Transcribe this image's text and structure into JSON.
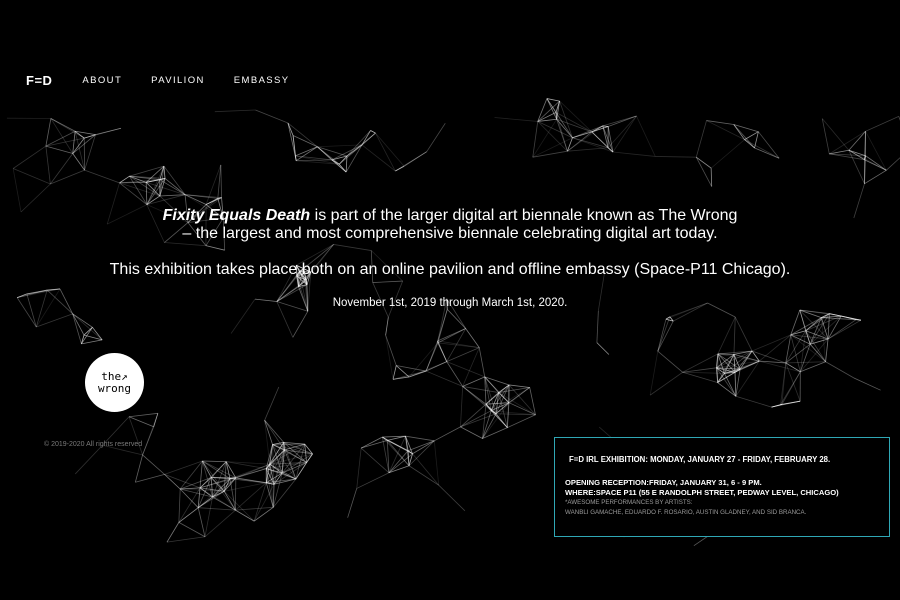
{
  "nav": {
    "logo": "F=D",
    "links": [
      "ABOUT",
      "PAVILION",
      "EMBASSY"
    ]
  },
  "intro": {
    "title": "Fixity Equals Death",
    "line1_rest": " is part of the larger digital art biennale known as The Wrong",
    "line2": "– the largest and most comprehensive biennale celebrating digital art today.",
    "exhibition": "This exhibition takes place both on an online pavilion and offline embassy (Space-P11 Chicago).",
    "dates": "November 1st, 2019 through March 1st, 2020."
  },
  "badge": {
    "line1": "the↗",
    "line2": "wrong"
  },
  "footer": {
    "copyright": "© 2019-2020 All rights reserved"
  },
  "irl": {
    "title": "F=D IRL EXHIBITION: MONDAY, JANUARY 27 - FRIDAY, FEBRUARY 28.",
    "reception": "OPENING RECEPTION:FRIDAY, JANUARY 31, 6 - 9 PM.",
    "where": "WHERE:SPACE P11 (55 E RANDOLPH STREET, PEDWAY LEVEL, CHICAGO)",
    "performances_label": "*AWESOME PERFORMANCES BY ARTISTS:",
    "artists": "WANBLI GAMACHE, EDUARDO F. ROSARIO, AUSTIN GLADNEY, AND SID BRANCA."
  },
  "colors": {
    "background": "#000000",
    "text": "#ffffff",
    "accent": "#2fa7b5",
    "muted": "#9a9a9a"
  }
}
